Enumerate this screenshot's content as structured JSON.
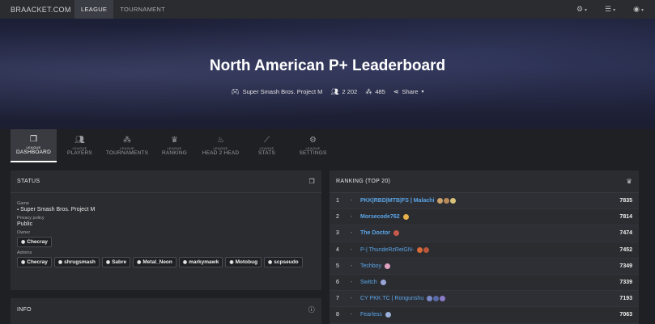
{
  "nav": {
    "brand": "BRAACKET.COM",
    "tabs": [
      {
        "label": "LEAGUE",
        "active": true
      },
      {
        "label": "TOURNAMENT",
        "active": false
      }
    ],
    "right_icons": [
      "gear-icon",
      "document-icon",
      "user-icon"
    ]
  },
  "hero": {
    "title": "North American P+ Leaderboard",
    "game": "Super Smash Bros. Project M",
    "players": "2 202",
    "tournaments": "485",
    "share": "Share"
  },
  "subnav": [
    {
      "small": "LEAGUE",
      "big": "DASHBOARD",
      "icon": "cube-icon",
      "active": true
    },
    {
      "small": "LEAGUE",
      "big": "PLAYERS",
      "icon": "users-icon",
      "active": false
    },
    {
      "small": "LEAGUE",
      "big": "TOURNAMENTS",
      "icon": "bracket-icon",
      "active": false
    },
    {
      "small": "LEAGUE",
      "big": "RANKING",
      "icon": "trophy-icon",
      "active": false
    },
    {
      "small": "LEAGUE",
      "big": "HEAD 2 HEAD",
      "icon": "fire-icon",
      "active": false
    },
    {
      "small": "LEAGUE",
      "big": "STATS",
      "icon": "chart-icon",
      "active": false
    },
    {
      "small": "LEAGUE",
      "big": "SETTINGS",
      "icon": "gears-icon",
      "active": false
    }
  ],
  "status": {
    "header": "STATUS",
    "game_label": "Game",
    "game_value": "Super Smash Bros. Project M",
    "privacy_label": "Privacy policy",
    "privacy_value": "Public",
    "owner_label": "Owner",
    "owner": "Checray",
    "admins_label": "Admins",
    "admins": [
      "Checray",
      "shrugsmash",
      "Sabre",
      "Metal_Neon",
      "markymawk",
      "Motobug",
      "scpseudo"
    ]
  },
  "info": {
    "header": "INFO"
  },
  "ranking": {
    "header": "RANKING (TOP 20)",
    "rows": [
      {
        "rank": "1",
        "dash": "-",
        "name": "PKK|RBD|MTB|FS | Malachi",
        "score": "7835",
        "bold": true,
        "emojis": [
          "#c9a36b",
          "#b88a5a",
          "#d8c27a"
        ]
      },
      {
        "rank": "2",
        "dash": "-",
        "name": "Morsecode762",
        "score": "7814",
        "bold": true,
        "emojis": [
          "#e6b04a"
        ]
      },
      {
        "rank": "3",
        "dash": "-",
        "name": "The Doctor",
        "score": "7474",
        "bold": true,
        "emojis": [
          "#c85a4a"
        ]
      },
      {
        "rank": "4",
        "dash": "-",
        "name": "P-| ThundeRzReiGN-",
        "score": "7452",
        "bold": false,
        "emojis": [
          "#d86a3a",
          "#b8563a"
        ]
      },
      {
        "rank": "5",
        "dash": "-",
        "name": "Techboy",
        "score": "7349",
        "bold": false,
        "emojis": [
          "#e0a0c0"
        ]
      },
      {
        "rank": "6",
        "dash": "-",
        "name": "Switch",
        "score": "7339",
        "bold": false,
        "emojis": [
          "#9aa6d8"
        ]
      },
      {
        "rank": "7",
        "dash": "-",
        "name": "CY PKK TC | Rongunshu",
        "score": "7193",
        "bold": false,
        "emojis": [
          "#7a8ac8",
          "#5a6aa8",
          "#8a7ac8"
        ]
      },
      {
        "rank": "8",
        "dash": "-",
        "name": "Fearless",
        "score": "7063",
        "bold": false,
        "emojis": [
          "#9ab0d8"
        ]
      }
    ],
    "score_header": ""
  }
}
